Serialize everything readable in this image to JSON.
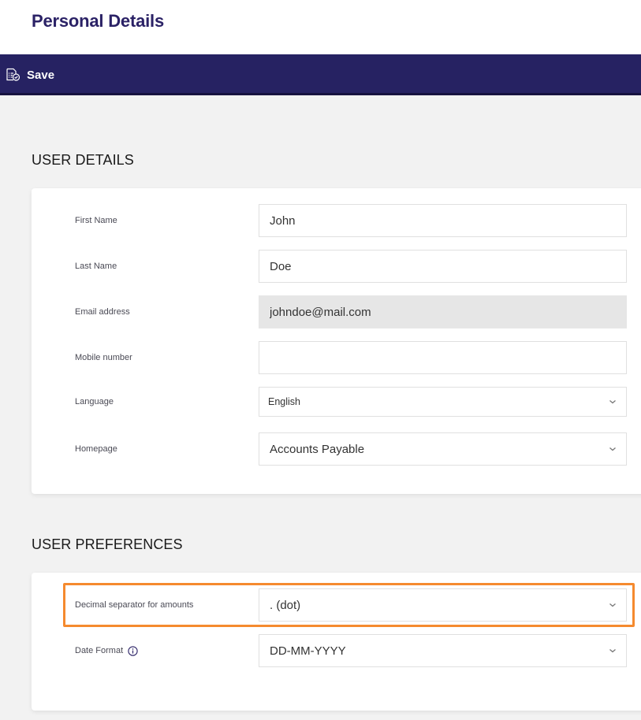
{
  "header": {
    "title": "Personal Details"
  },
  "toolbar": {
    "save_label": "Save",
    "save_icon": "document-check-icon"
  },
  "sections": {
    "user_details": {
      "title": "USER DETAILS",
      "fields": {
        "first_name": {
          "label": "First Name",
          "value": "John",
          "type": "text"
        },
        "last_name": {
          "label": "Last Name",
          "value": "Doe",
          "type": "text"
        },
        "email": {
          "label": "Email address",
          "value": "johndoe@mail.com",
          "type": "text",
          "readonly": true
        },
        "mobile": {
          "label": "Mobile number",
          "value": "",
          "type": "text"
        },
        "language": {
          "label": "Language",
          "value": "English",
          "type": "select"
        },
        "homepage": {
          "label": "Homepage",
          "value": "Accounts Payable",
          "type": "select"
        }
      }
    },
    "user_preferences": {
      "title": "USER PREFERENCES",
      "fields": {
        "decimal_separator": {
          "label": "Decimal separator for amounts",
          "value": ". (dot)",
          "type": "select",
          "highlighted": true
        },
        "date_format": {
          "label": "Date Format",
          "value": "DD-MM-YYYY",
          "type": "select",
          "info_icon": "info-icon"
        }
      }
    }
  },
  "colors": {
    "brand": "#262262",
    "title": "#2b2266",
    "highlight": "#f58a2e",
    "background": "#f2f2f2",
    "readonly_field": "#e6e6e6"
  }
}
